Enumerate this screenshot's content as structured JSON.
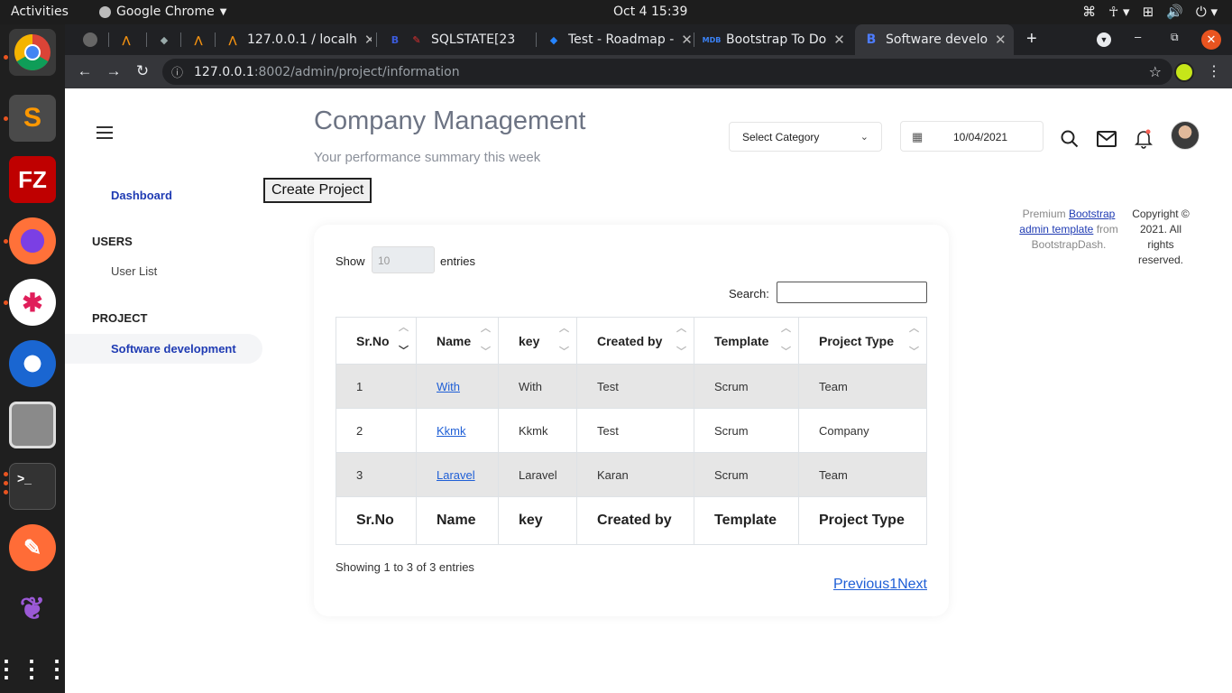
{
  "os": {
    "activities": "Activities",
    "app_name": "Google Chrome",
    "clock": "Oct 4  15:39"
  },
  "browser": {
    "tabs": [
      {
        "title": "",
        "favicon": "globe-icon"
      },
      {
        "title": "",
        "favicon": "pma-icon"
      },
      {
        "title": "",
        "favicon": "diamond-icon"
      },
      {
        "title": "",
        "favicon": "pma-icon"
      },
      {
        "title": "127.0.0.1 / localh",
        "favicon": "pma-icon"
      },
      {
        "title": "",
        "favicon": "bootstrap-icon"
      },
      {
        "title": "SQLSTATE[23",
        "favicon": "ignition-icon"
      },
      {
        "title": "Test - Roadmap -",
        "favicon": "jira-icon"
      },
      {
        "title": "Bootstrap To Do",
        "favicon": "mdb-icon"
      },
      {
        "title": "Software develo",
        "favicon": "bootstrap-icon"
      }
    ],
    "url_host": "127.0.0.1",
    "url_path": ":8002/admin/project/information"
  },
  "header": {
    "title": "Company Management",
    "subtitle": "Your performance summary this week",
    "category_select": "Select Category",
    "date": "10/04/2021"
  },
  "sidebar": {
    "dashboard": "Dashboard",
    "users_heading": "USERS",
    "user_list": "User List",
    "project_heading": "PROJECT",
    "software_development": "Software development"
  },
  "actions": {
    "create_project": "Create Project"
  },
  "footer": {
    "premium": "Premium",
    "link": "Bootstrap admin template",
    "from": "from BootstrapDash.",
    "copyright": "Copyright © 2021. All rights reserved."
  },
  "table": {
    "show_label": "Show",
    "page_length": "10",
    "entries_label": "entries",
    "search_label": "Search:",
    "columns": [
      "Sr.No",
      "Name",
      "key",
      "Created by",
      "Template",
      "Project Type"
    ],
    "rows": [
      [
        "1",
        "With",
        "With",
        "Test",
        "Scrum",
        "Team"
      ],
      [
        "2",
        "Kkmk",
        "Kkmk",
        "Test",
        "Scrum",
        "Company"
      ],
      [
        "3",
        "Laravel",
        "Laravel",
        "Karan",
        "Scrum",
        "Team"
      ]
    ],
    "info": "Showing 1 to 3 of 3 entries",
    "pagination": {
      "previous": "Previous",
      "page": "1",
      "next": "Next"
    }
  }
}
